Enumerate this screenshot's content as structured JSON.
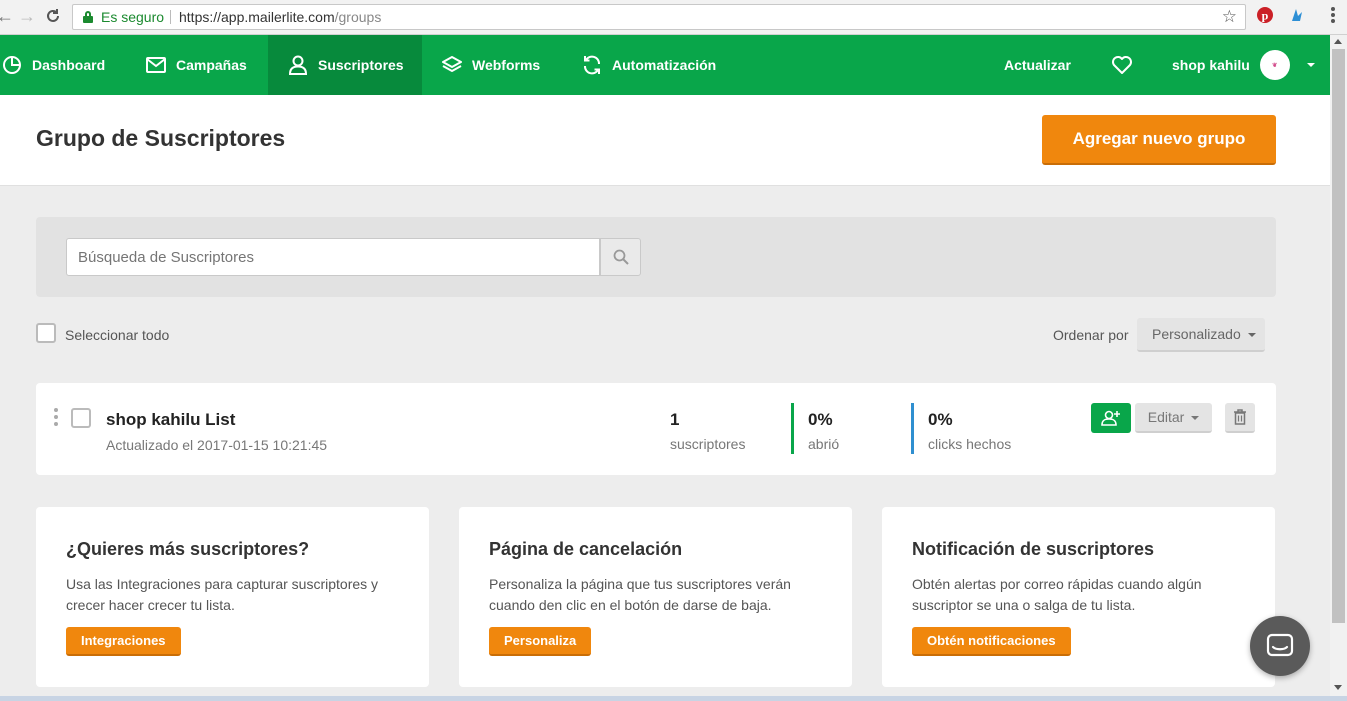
{
  "browser": {
    "secure_label": "Es seguro",
    "url_host": "https://app.mailerlite.com",
    "url_path": "/groups"
  },
  "nav": {
    "items": [
      {
        "label": "Dashboard",
        "icon": "pie-chart-icon"
      },
      {
        "label": "Campañas",
        "icon": "envelope-icon"
      },
      {
        "label": "Suscriptores",
        "icon": "user-icon"
      },
      {
        "label": "Webforms",
        "icon": "layers-icon"
      },
      {
        "label": "Automatización",
        "icon": "refresh-icon"
      }
    ],
    "active": "Suscriptores",
    "update_label": "Actualizar",
    "account_name": "shop kahilu"
  },
  "page": {
    "title": "Grupo de Suscriptores",
    "add_group_label": "Agregar nuevo grupo"
  },
  "search": {
    "placeholder": "Búsqueda de Suscriptores"
  },
  "list_controls": {
    "select_all_label": "Seleccionar todo",
    "order_label": "Ordenar por",
    "order_value": "Personalizado"
  },
  "groups": [
    {
      "name": "shop kahilu List",
      "updated": "Actualizado el 2017-01-15 10:21:45",
      "subscribers": "1",
      "subscribers_label": "suscriptores",
      "opened": "0%",
      "opened_label": "abrió",
      "clicks": "0%",
      "clicks_label": "clicks hechos",
      "edit_label": "Editar"
    }
  ],
  "cards": [
    {
      "title": "¿Quieres más suscriptores?",
      "text": "Usa las Integraciones para capturar suscriptores y crecer hacer crecer tu lista.",
      "button": "Integraciones"
    },
    {
      "title": "Página de cancelación",
      "text": "Personaliza la página que tus suscriptores verán cuando den clic en el botón de darse de baja.",
      "button": "Personaliza"
    },
    {
      "title": "Notificación de suscriptores",
      "text": "Obtén alertas por correo rápidas cuando algún suscriptor se una o salga de tu lista.",
      "button": "Obtén notificaciones"
    }
  ],
  "colors": {
    "brand_green": "#09a64a",
    "accent_orange": "#f0870d",
    "opened_bar": "#09a64a",
    "clicks_bar": "#2f8fd0"
  }
}
